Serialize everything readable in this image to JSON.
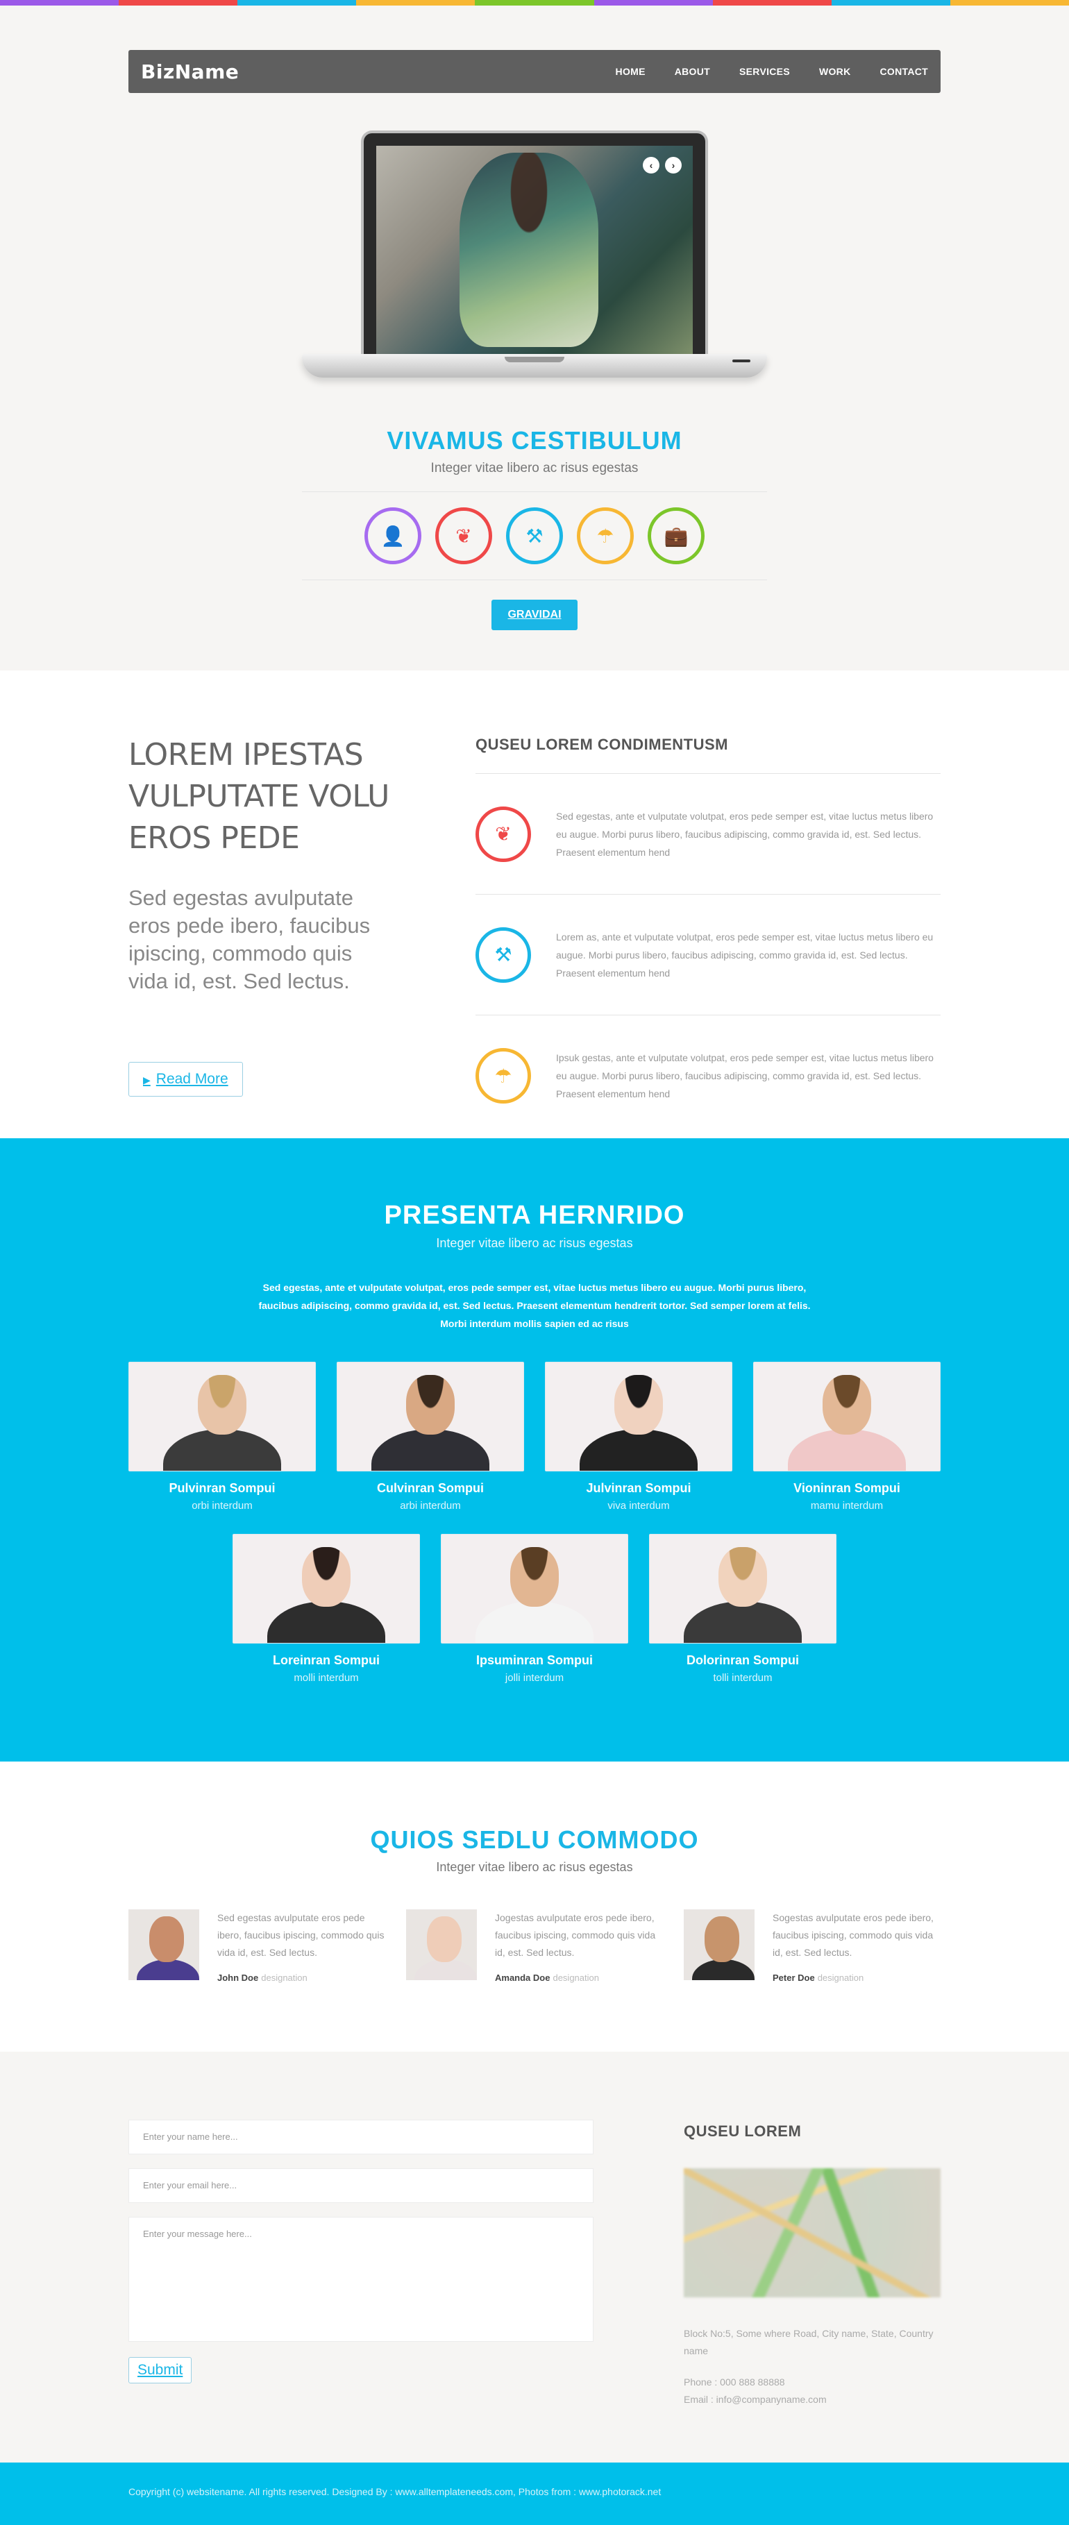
{
  "strip_colors": [
    "#9b59e8",
    "#ef4848",
    "#1ab6e6",
    "#f7b733",
    "#7cc62a",
    "#9b59e8",
    "#ef4848",
    "#1ab6e6",
    "#f7b733"
  ],
  "colors": {
    "accent": "#1ab6e6",
    "team_bg": "#00bfea",
    "purple": "#a66bf0",
    "red": "#ef4848",
    "blue": "#1ab6e6",
    "orange": "#f7b733",
    "green": "#7cc62a"
  },
  "header": {
    "brand": "BizName",
    "nav": [
      "HOME",
      "ABOUT",
      "SERVICES",
      "WORK",
      "CONTACT"
    ]
  },
  "hero": {
    "slider_prev": "‹",
    "slider_next": "›",
    "title": "VIVAMUS CESTIBULUM",
    "subtitle": "Integer vitae libero ac risus egestas",
    "icons": [
      {
        "name": "user-icon",
        "glyph": "👤",
        "color": "#a66bf0"
      },
      {
        "name": "leaf-icon",
        "glyph": "❦",
        "color": "#ef4848"
      },
      {
        "name": "gavel-icon",
        "glyph": "⚒",
        "color": "#1ab6e6"
      },
      {
        "name": "umbrella-icon",
        "glyph": "☂",
        "color": "#f7b733"
      },
      {
        "name": "briefcase-icon",
        "glyph": "💼",
        "color": "#7cc62a"
      }
    ],
    "button": "GRAVIDAI"
  },
  "features": {
    "heading": "LOREM IPESTAS VULPUTATE VOLU EROS PEDE",
    "lead": "Sed egestas avulputate eros pede ibero, faucibus ipiscing, commodo quis vida id, est. Sed lectus.",
    "button": "Read More",
    "list_title": "QUSEU LOREM CONDIMENTUSM",
    "items": [
      {
        "icon": "leaf-icon",
        "glyph": "❦",
        "color": "#ef4848",
        "text": "Sed egestas, ante et vulputate volutpat, eros pede semper est, vitae luctus metus libero eu augue. Morbi purus libero, faucibus adipiscing, commo gravida id, est. Sed lectus. Praesent elementum hend"
      },
      {
        "icon": "gavel-icon",
        "glyph": "⚒",
        "color": "#1ab6e6",
        "text": "Lorem as, ante et vulputate volutpat, eros pede semper est, vitae luctus metus libero eu augue. Morbi purus libero, faucibus adipiscing, commo gravida id, est. Sed lectus. Praesent elementum hend"
      },
      {
        "icon": "umbrella-icon",
        "glyph": "☂",
        "color": "#f7b733",
        "text": "Ipsuk gestas, ante et vulputate volutpat, eros pede semper est, vitae luctus metus libero eu augue. Morbi purus libero, faucibus adipiscing, commo gravida id, est. Sed lectus. Praesent elementum hend"
      }
    ]
  },
  "team": {
    "title": "PRESENTA HERNRIDO",
    "subtitle": "Integer vitae libero ac risus egestas",
    "intro": "Sed egestas, ante et vulputate volutpat, eros pede semper est, vitae luctus metus libero eu augue. Morbi purus libero, faucibus adipiscing, commo gravida id, est. Sed lectus. Praesent elementum hendrerit tortor. Sed semper lorem at felis. Morbi interdum mollis sapien ed ac risus",
    "members": [
      {
        "name": "Pulvinran Sompui",
        "role": "orbi interdum",
        "skin": "#e8c4a8",
        "hair": "#caa46a",
        "suit": "#3b3b3b"
      },
      {
        "name": "Culvinran Sompui",
        "role": "arbi interdum",
        "skin": "#d9a883",
        "hair": "#3a2a1e",
        "suit": "#2f2f35"
      },
      {
        "name": "Julvinran Sompui",
        "role": "viva interdum",
        "skin": "#f0d2bf",
        "hair": "#1c1a1a",
        "suit": "#222"
      },
      {
        "name": "Vioninran Sompui",
        "role": "mamu interdum",
        "skin": "#e3b896",
        "hair": "#6b4a2a",
        "suit": "#f0c8c8"
      },
      {
        "name": "Loreinran Sompui",
        "role": "molli interdum",
        "skin": "#efcdb8",
        "hair": "#2a1e1a",
        "suit": "#2d2d2d"
      },
      {
        "name": "Ipsuminran Sompui",
        "role": "jolli interdum",
        "skin": "#e2b692",
        "hair": "#5a3e24",
        "suit": "#f4f4f4"
      },
      {
        "name": "Dolorinran Sompui",
        "role": "tolli interdum",
        "skin": "#f1d3bd",
        "hair": "#c9a16a",
        "suit": "#3a3a3a"
      }
    ]
  },
  "testimonials": {
    "title": "QUIOS SEDLU COMMODO",
    "subtitle": "Integer vitae libero ac risus egestas",
    "items": [
      {
        "text": "Sed egestas avulputate eros pede ibero, faucibus ipiscing, commodo quis vida id, est. Sed lectus.",
        "author": "John Doe",
        "role": "designation",
        "skin": "#c98d6b",
        "suit": "#4a3d8f"
      },
      {
        "text": "Jogestas avulputate eros pede ibero, faucibus ipiscing, commodo quis vida id, est. Sed lectus.",
        "author": "Amanda Doe",
        "role": "designation",
        "skin": "#efcdb8",
        "suit": "#e9e2e2"
      },
      {
        "text": "Sogestas avulputate eros pede ibero, faucibus ipiscing, commodo quis vida id, est. Sed lectus.",
        "author": "Peter Doe",
        "role": "designation",
        "skin": "#c7946c",
        "suit": "#2a2a2a"
      }
    ]
  },
  "contact": {
    "name_placeholder": "Enter your name here...",
    "email_placeholder": "Enter your email here...",
    "message_placeholder": "Enter your message here...",
    "submit": "Submit",
    "side_title": "QUSEU LOREM",
    "address": "Block No:5, Some where Road,  City name, State, Country name",
    "phone": "Phone : 000 888 88888",
    "email": "Email : info@companyname.com"
  },
  "footer": {
    "text": "Copyright (c) websitename. All rights reserved. Designed By : www.alltemplateneeds.com,  Photos from : www.photorack.net"
  }
}
